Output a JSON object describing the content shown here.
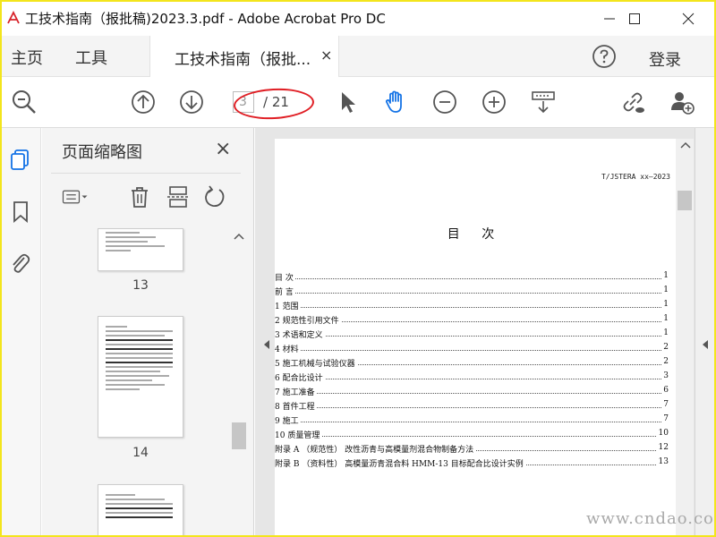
{
  "window": {
    "title": "工技术指南（报批稿)2023.3.pdf - Adobe Acrobat Pro DC",
    "accent_color": "#f3e51c"
  },
  "nav": {
    "home": "主页",
    "tools": "工具",
    "tab_label": "工技术指南（报批...",
    "tab_close": "×",
    "login": "登录"
  },
  "toolbar": {
    "current_page": "3",
    "total_pages": "/ 21"
  },
  "panel": {
    "title": "页面缩略图",
    "close": "×",
    "thumbnails": [
      {
        "label": "13"
      },
      {
        "label": "14"
      },
      {
        "label": ""
      }
    ]
  },
  "document": {
    "header_code": "T/JSTERA xx—2023",
    "toc_title": "目 次",
    "toc": [
      {
        "text": "目  次",
        "page": "1"
      },
      {
        "text": "前  言",
        "page": "1"
      },
      {
        "text": "1  范围",
        "page": "1"
      },
      {
        "text": "2  规范性引用文件",
        "page": "1"
      },
      {
        "text": "3  术语和定义",
        "page": "1"
      },
      {
        "text": "4  材料",
        "page": "2"
      },
      {
        "text": "5  施工机械与试验仪器",
        "page": "2"
      },
      {
        "text": "6  配合比设计",
        "page": "3"
      },
      {
        "text": "7  施工准备",
        "page": "6"
      },
      {
        "text": "8  首件工程",
        "page": "7"
      },
      {
        "text": "9  施工",
        "page": "7"
      },
      {
        "text": "10  质量管理",
        "page": "10"
      },
      {
        "text": "附录 A （规范性） 改性沥青与高模量剂混合物制备方法",
        "page": "12"
      },
      {
        "text": "附录 B （资料性） 高模量沥青混合料 HMM-13 目标配合比设计实例",
        "page": "13"
      }
    ]
  },
  "watermark": "www.cndao.com"
}
